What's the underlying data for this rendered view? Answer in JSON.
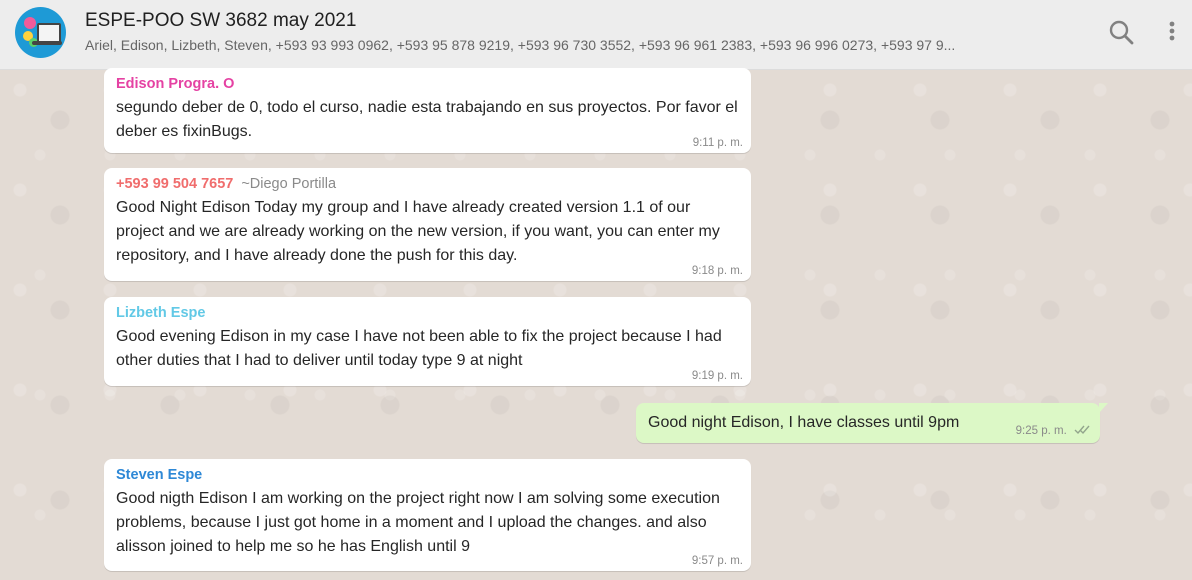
{
  "chat": {
    "title": "ESPE-POO SW 3682 may 2021",
    "members": "Ariel, Edison, Lizbeth, Steven, +593 93 993 0962, +593 95 878 9219, +593 96 730 3552, +593 96 961 2383, +593 96 996 0273, +593 97 9..."
  },
  "icons": {
    "avatar": "group-avatar",
    "search": "search-icon",
    "menu": "menu-icon",
    "read_receipt": "double-check-icon"
  },
  "colors": {
    "header_bg": "#ededed",
    "chat_bg": "#e5ddd5",
    "incoming_bubble": "#ffffff",
    "outgoing_bubble": "#dcf8c6",
    "sender_edison": "#e542a3",
    "sender_phone": "#f06d6d",
    "sender_lizbeth": "#62c9e6",
    "sender_steven": "#2e88d6"
  },
  "messages": [
    {
      "sender": "Edison Progra. O",
      "text": "segundo deber de 0, todo el curso, nadie esta trabajando en sus proyectos. Por favor el deber es fixinBugs.",
      "time": "9:11 p. m."
    },
    {
      "sender": "+593 99 504 7657",
      "pushname": "~Diego Portilla",
      "text": "Good Night Edison Today my group and I have already created version 1.1 of our project and we are already working on the new version, if you want, you can enter my repository, and I have already done the push for this day.",
      "time": "9:18 p. m."
    },
    {
      "sender": "Lizbeth Espe",
      "text": "Good evening Edison in my case I have not been able to fix the project because I had other duties that I had to deliver until today type 9 at night",
      "time": "9:19 p. m."
    },
    {
      "text": "Good night Edison, I have classes until 9pm",
      "time": "9:25 p. m."
    },
    {
      "sender": "Steven Espe",
      "text": "Good nigth Edison I am working on the project right now I am solving some execution problems, because I just got home in a moment and I upload the changes. and also alisson joined to help me so he has English until 9",
      "time": "9:57 p. m."
    }
  ]
}
